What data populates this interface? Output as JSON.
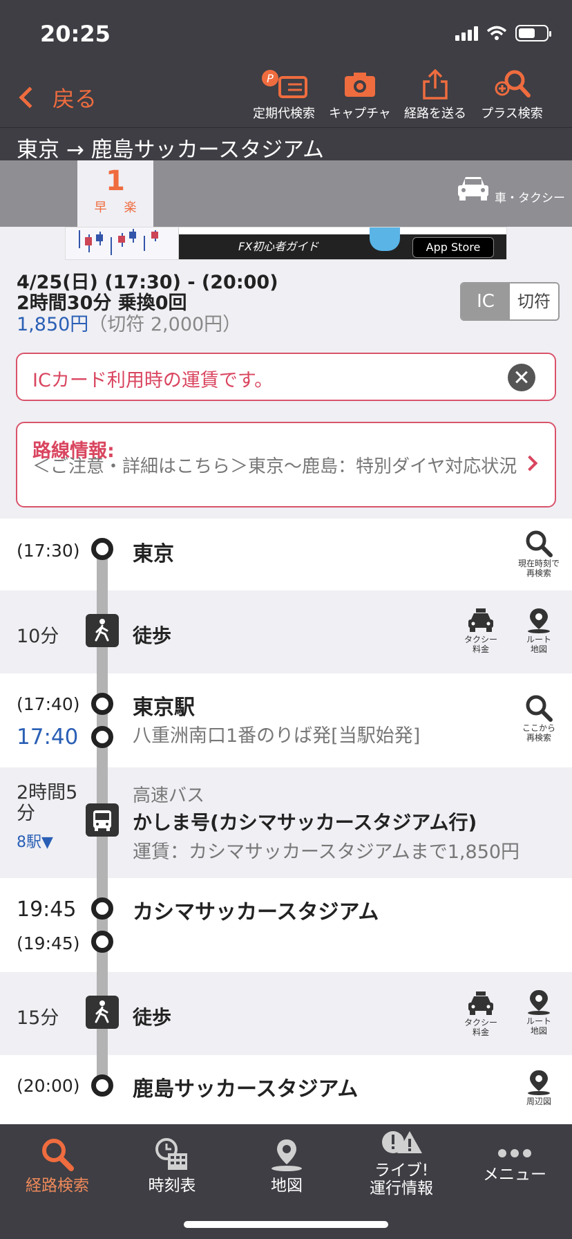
{
  "status": {
    "time": "20:25"
  },
  "header": {
    "back_label": "戻る",
    "tools": [
      {
        "label": "定期代検索",
        "icon": "commuter-pass-icon"
      },
      {
        "label": "キャプチャ",
        "icon": "camera-icon"
      },
      {
        "label": "経路を送る",
        "icon": "share-icon"
      },
      {
        "label": "プラス検索",
        "icon": "plus-search-icon"
      }
    ],
    "route_title": "東京 → 鹿島サッカースタジアム"
  },
  "tabs": {
    "active_number": "1",
    "active_tags": [
      "早",
      "楽"
    ],
    "taxi_label": "車・タクシー"
  },
  "ad": {
    "fx_text": "FX初心者ガイド",
    "store_text": "App Store"
  },
  "summary": {
    "date_time": "4/25(日) (17:30) - (20:00)",
    "duration": "2時間30分 乗換0回",
    "ic_fare": "1,850円",
    "ticket_fare": "（切符 2,000円）",
    "toggle_ic": "IC",
    "toggle_ticket": "切符"
  },
  "notice_ic": "ICカード利用時の運賃です。",
  "route_info": {
    "heading": "路線情報:",
    "body": "＜ご注意・詳細はこちら＞東京〜鹿島：特別ダイヤ対応状況"
  },
  "itinerary": {
    "start_time": "(17:30)",
    "start_station": "東京",
    "research_now": [
      "現在時刻で",
      "再検索"
    ],
    "walk1_minutes": "10分",
    "walk_label": "徒歩",
    "taxi_fare": [
      "タクシー",
      "料金"
    ],
    "route_map": [
      "ルート",
      "地図"
    ],
    "stop2_arr": "(17:40)",
    "stop2_dep": "17:40",
    "stop2_station": "東京駅",
    "stop2_platform": "八重洲南口1番のりば発[当駅始発]",
    "research_here": [
      "ここから",
      "再検索"
    ],
    "bus_duration": "2時間5分",
    "bus_stations": "8駅▼",
    "bus_type": "高速バス",
    "bus_name": "かしま号(カシマサッカースタジアム行)",
    "bus_fare": "運賃：カシマサッカースタジアムまで1,850円",
    "stop3_arr": "19:45",
    "stop3_dep": "(19:45)",
    "stop3_station": "カシマサッカースタジアム",
    "walk2_minutes": "15分",
    "end_time": "(20:00)",
    "end_station": "鹿島サッカースタジアム",
    "surrounding_map": "周辺図"
  },
  "tabbar": [
    {
      "label": "経路検索",
      "icon": "search-icon"
    },
    {
      "label": "時刻表",
      "icon": "timetable-icon"
    },
    {
      "label": "地図",
      "icon": "map-pin-icon"
    },
    {
      "label": "ライブ!運行情報",
      "line1": "ライブ!",
      "line2": "運行情報",
      "icon": "live-info-icon"
    },
    {
      "label": "メニュー",
      "icon": "menu-dots-icon"
    }
  ],
  "colors": {
    "accent": "#ef6c3f",
    "header_bg": "#3e3e44",
    "alert": "#d9455f",
    "ic_blue": "#2a5fb5"
  }
}
